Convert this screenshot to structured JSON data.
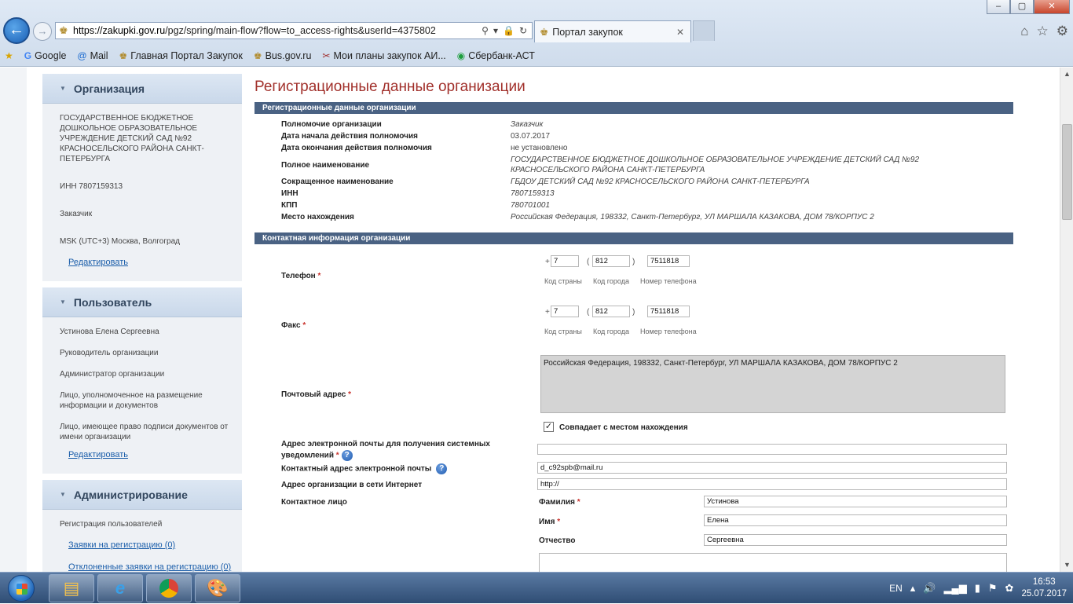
{
  "browser": {
    "url_host": "https://zakupki.gov.ru",
    "url_path": "/pgz/spring/main-flow?flow=to_access-rights&userId=4375802",
    "tab_title": "Портал закупок",
    "window": {
      "minimize": "–",
      "maximize": "▢",
      "close": "✕"
    },
    "favorites": [
      {
        "label": "Google",
        "icon": "google-icon"
      },
      {
        "label": "Mail",
        "icon": "mail-icon"
      },
      {
        "label": "Главная Портал Закупок",
        "icon": "emblem-icon"
      },
      {
        "label": "Bus.gov.ru",
        "icon": "emblem-icon"
      },
      {
        "label": "Мои планы закупок  АИ...",
        "icon": "tools-icon"
      },
      {
        "label": "Сбербанк-АСТ",
        "icon": "sber-icon"
      }
    ]
  },
  "sidebar": {
    "org": {
      "title": "Организация",
      "name": "ГОСУДАРСТВЕННОЕ БЮДЖЕТНОЕ ДОШКОЛЬНОЕ ОБРАЗОВАТЕЛЬНОЕ УЧРЕЖДЕНИЕ ДЕТСКИЙ САД №92 КРАСНОСЕЛЬСКОГО РАЙОНА САНКТ-ПЕТЕРБУРГА",
      "inn": "ИНН 7807159313",
      "role": "Заказчик",
      "tz": "MSK (UTC+3) Москва, Волгоград",
      "edit": "Редактировать"
    },
    "user": {
      "title": "Пользователь",
      "name": "Устинова Елена Сергеевна",
      "r1": "Руководитель организации",
      "r2": "Администратор организации",
      "r3": "Лицо, уполномоченное на размещение информации и документов",
      "r4": "Лицо, имеющее право подписи документов от имени организации",
      "edit": "Редактировать"
    },
    "admin": {
      "title": "Администрирование",
      "reg": "Регистрация пользователей",
      "link1": "Заявки на регистрацию (0)",
      "link2": "Отклоненные заявки на регистрацию (0)"
    }
  },
  "main": {
    "title": "Регистрационные данные организации",
    "section1": "Регистрационные данные организации",
    "reg": {
      "l1": "Полномочие организации",
      "v1": "Заказчик",
      "l2": "Дата начала действия полномочия",
      "v2": "03.07.2017",
      "l3": "Дата окончания действия полномочия",
      "v3": "не установлено",
      "l4": "Полное наименование",
      "v4": "ГОСУДАРСТВЕННОЕ БЮДЖЕТНОЕ ДОШКОЛЬНОЕ ОБРАЗОВАТЕЛЬНОЕ УЧРЕЖДЕНИЕ ДЕТСКИЙ САД №92 КРАСНОСЕЛЬСКОГО РАЙОНА САНКТ-ПЕТЕРБУРГА",
      "l5": "Сокращенное наименование",
      "v5": "ГБДОУ ДЕТСКИЙ САД №92 КРАСНОСЕЛЬСКОГО РАЙОНА САНКТ-ПЕТЕРБУРГА",
      "l6": "ИНН",
      "v6": "7807159313",
      "l7": "КПП",
      "v7": "780701001",
      "l8": "Место нахождения",
      "v8": "Российская Федерация, 198332, Санкт-Петербург, УЛ МАРШАЛА КАЗАКОВА, ДОМ 78/КОРПУС 2"
    },
    "section2": "Контактная информация организации",
    "contact": {
      "phone_label": "Телефон",
      "fax_label": "Факс",
      "plus": "+",
      "paren_open": "(",
      "paren_close": ")",
      "phone": {
        "country": "7",
        "city": "812",
        "number": "7511818"
      },
      "fax": {
        "country": "7",
        "city": "812",
        "number": "7511818"
      },
      "cap_country": "Код страны",
      "cap_city": "Код города",
      "cap_number": "Номер телефона",
      "postal_label": "Почтовый адрес",
      "postal_value": "Российская Федерация, 198332, Санкт-Петербург, УЛ МАРШАЛА КАЗАКОВА, ДОМ 78/КОРПУС 2",
      "same_as_location": "Совпадает с местом нахождения",
      "sys_email_label": "Адрес электронной почты для получения системных уведомлений",
      "sys_email_value": "",
      "contact_email_label": "Контактный адрес электронной почты",
      "contact_email_value": "d_c92spb@mail.ru",
      "website_label": "Адрес организации в сети Интернет",
      "website_value": "http://",
      "person_label": "Контактное лицо",
      "surname_label": "Фамилия",
      "surname": "Устинова",
      "name_label": "Имя",
      "name": "Елена",
      "patronymic_label": "Отчество",
      "patronymic": "Сергеевна",
      "required_mark": "*",
      "help_mark": "?"
    }
  },
  "taskbar": {
    "lang": "EN",
    "time": "16:53",
    "date": "25.07.2017"
  }
}
